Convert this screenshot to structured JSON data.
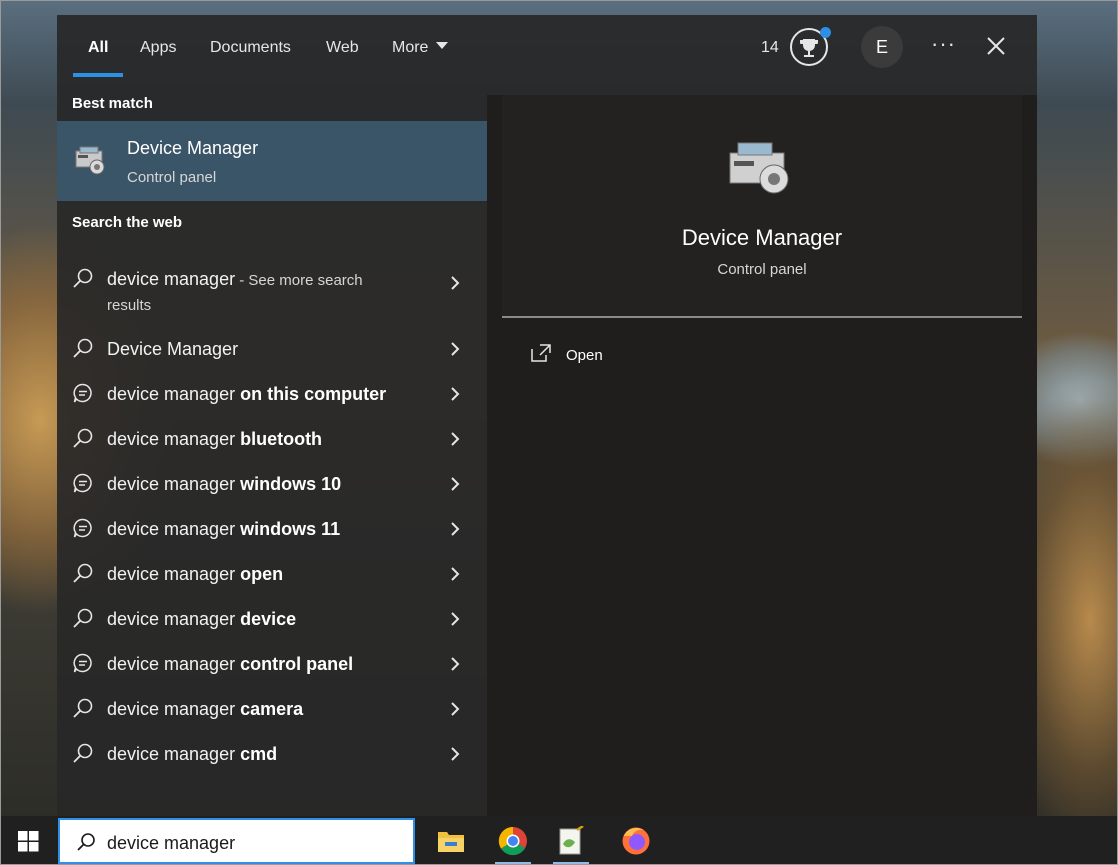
{
  "tabs": [
    {
      "label": "All",
      "active": true
    },
    {
      "label": "Apps",
      "active": false
    },
    {
      "label": "Documents",
      "active": false
    },
    {
      "label": "Web",
      "active": false
    },
    {
      "label": "More",
      "active": false
    }
  ],
  "header": {
    "points": "14",
    "avatar_initial": "E",
    "more_options": "···"
  },
  "best_match": {
    "section_label": "Best match",
    "title": "Device Manager",
    "subtitle": "Control panel",
    "icon": "device-manager-icon"
  },
  "web": {
    "section_label": "Search the web",
    "items": [
      {
        "icon": "search-icon",
        "prefix": "device manager",
        "bold": "",
        "suffix": " - See more search",
        "suffix2": "results"
      },
      {
        "icon": "search-icon",
        "prefix": "Device Manager",
        "bold": ""
      },
      {
        "icon": "chat-icon",
        "prefix": "device manager ",
        "bold": "on this computer"
      },
      {
        "icon": "search-icon",
        "prefix": "device manager ",
        "bold": "bluetooth"
      },
      {
        "icon": "chat-icon",
        "prefix": "device manager ",
        "bold": "windows 10"
      },
      {
        "icon": "chat-icon",
        "prefix": "device manager ",
        "bold": "windows 11"
      },
      {
        "icon": "search-icon",
        "prefix": "device manager ",
        "bold": "open"
      },
      {
        "icon": "search-icon",
        "prefix": "device manager ",
        "bold": "device"
      },
      {
        "icon": "chat-icon",
        "prefix": "device manager ",
        "bold": "control panel"
      },
      {
        "icon": "search-icon",
        "prefix": "device manager ",
        "bold": "camera"
      },
      {
        "icon": "search-icon",
        "prefix": "device manager ",
        "bold": "cmd"
      }
    ]
  },
  "preview": {
    "title": "Device Manager",
    "subtitle": "Control panel",
    "actions": [
      {
        "label": "Open",
        "icon": "open-external-icon"
      }
    ]
  },
  "taskbar": {
    "search_value": "device manager",
    "apps": [
      "file-explorer-icon",
      "chrome-icon",
      "notepad-plus-plus-icon",
      "firefox-icon"
    ]
  },
  "colors": {
    "accent": "#2d8fe6",
    "selected_row": "#3b5568",
    "panel_bg": "#282828"
  }
}
